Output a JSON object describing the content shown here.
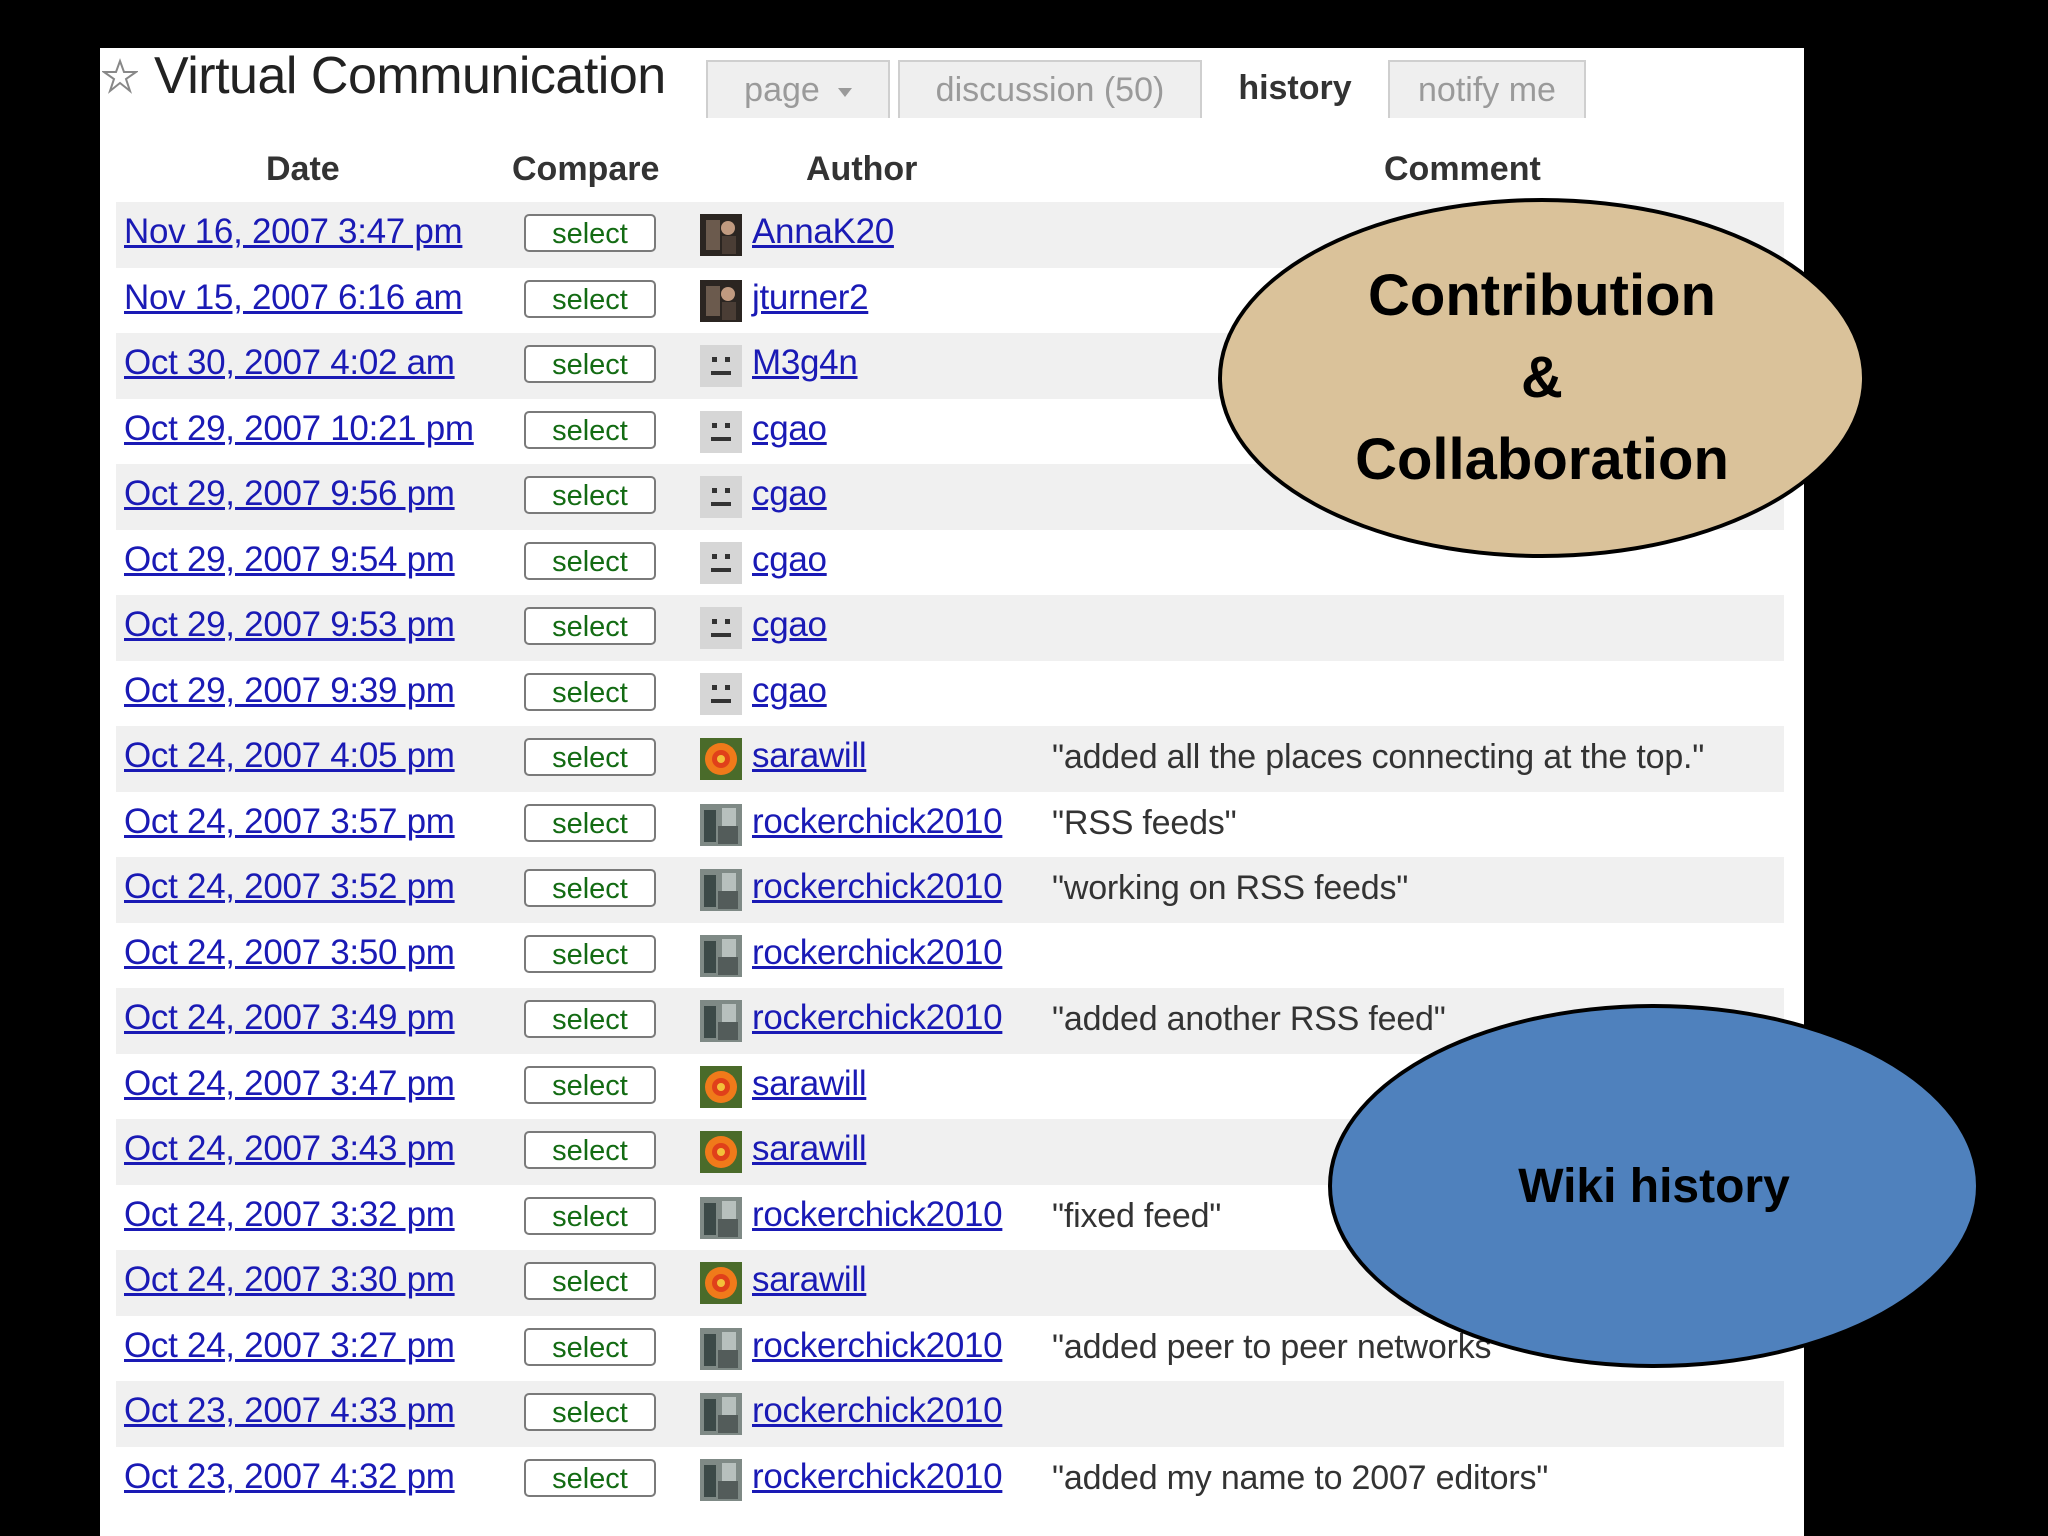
{
  "page": {
    "title": "Virtual Communication",
    "tabs": [
      {
        "label": "page"
      },
      {
        "label": "discussion (50)"
      },
      {
        "label": "history"
      },
      {
        "label": "notify me"
      }
    ]
  },
  "table": {
    "headers": {
      "date": "Date",
      "compare": "Compare",
      "author": "Author",
      "comment": "Comment"
    },
    "rows": [
      {
        "date": "Nov 16, 2007 3:47 pm",
        "select": "select",
        "author": "AnnaK20",
        "avatar": "photo",
        "comment": ""
      },
      {
        "date": "Nov 15, 2007 6:16 am",
        "select": "select",
        "author": "jturner2",
        "avatar": "photo",
        "comment": ""
      },
      {
        "date": "Oct 30, 2007 4:02 am",
        "select": "select",
        "author": "M3g4n",
        "avatar": "face",
        "comment": ""
      },
      {
        "date": "Oct 29, 2007 10:21 pm",
        "select": "select",
        "author": "cgao",
        "avatar": "face",
        "comment": ""
      },
      {
        "date": "Oct 29, 2007 9:56 pm",
        "select": "select",
        "author": "cgao",
        "avatar": "face",
        "comment": ""
      },
      {
        "date": "Oct 29, 2007 9:54 pm",
        "select": "select",
        "author": "cgao",
        "avatar": "face",
        "comment": ""
      },
      {
        "date": "Oct 29, 2007 9:53 pm",
        "select": "select",
        "author": "cgao",
        "avatar": "face",
        "comment": ""
      },
      {
        "date": "Oct 29, 2007 9:39 pm",
        "select": "select",
        "author": "cgao",
        "avatar": "face",
        "comment": ""
      },
      {
        "date": "Oct 24, 2007 4:05 pm",
        "select": "select",
        "author": "sarawill",
        "avatar": "flower",
        "comment": "\"added all the places connecting at the top.\""
      },
      {
        "date": "Oct 24, 2007 3:57 pm",
        "select": "select",
        "author": "rockerchick2010",
        "avatar": "photo2",
        "comment": "\"RSS feeds\""
      },
      {
        "date": "Oct 24, 2007 3:52 pm",
        "select": "select",
        "author": "rockerchick2010",
        "avatar": "photo2",
        "comment": "\"working on RSS feeds\""
      },
      {
        "date": "Oct 24, 2007 3:50 pm",
        "select": "select",
        "author": "rockerchick2010",
        "avatar": "photo2",
        "comment": ""
      },
      {
        "date": "Oct 24, 2007 3:49 pm",
        "select": "select",
        "author": "rockerchick2010",
        "avatar": "photo2",
        "comment": "\"added another RSS feed\""
      },
      {
        "date": "Oct 24, 2007 3:47 pm",
        "select": "select",
        "author": "sarawill",
        "avatar": "flower",
        "comment": ""
      },
      {
        "date": "Oct 24, 2007 3:43 pm",
        "select": "select",
        "author": "sarawill",
        "avatar": "flower",
        "comment": ""
      },
      {
        "date": "Oct 24, 2007 3:32 pm",
        "select": "select",
        "author": "rockerchick2010",
        "avatar": "photo2",
        "comment": "\"fixed feed\""
      },
      {
        "date": "Oct 24, 2007 3:30 pm",
        "select": "select",
        "author": "sarawill",
        "avatar": "flower",
        "comment": ""
      },
      {
        "date": "Oct 24, 2007 3:27 pm",
        "select": "select",
        "author": "rockerchick2010",
        "avatar": "photo2",
        "comment": "\"added peer to peer networks"
      },
      {
        "date": "Oct 23, 2007 4:33 pm",
        "select": "select",
        "author": "rockerchick2010",
        "avatar": "photo2",
        "comment": ""
      },
      {
        "date": "Oct 23, 2007 4:32 pm",
        "select": "select",
        "author": "rockerchick2010",
        "avatar": "photo2",
        "comment": "\"added my name to 2007 editors\""
      }
    ]
  },
  "callouts": {
    "collab": {
      "line1": "Contribution",
      "line2": "&",
      "line3": "Collaboration",
      "color": "#dac29a"
    },
    "history": {
      "label": "Wiki history",
      "color": "#4f81bd"
    }
  },
  "colors": {
    "link": "#1a1ab5",
    "select_text": "#136b13",
    "row_stripe": "#f0f0f0"
  }
}
